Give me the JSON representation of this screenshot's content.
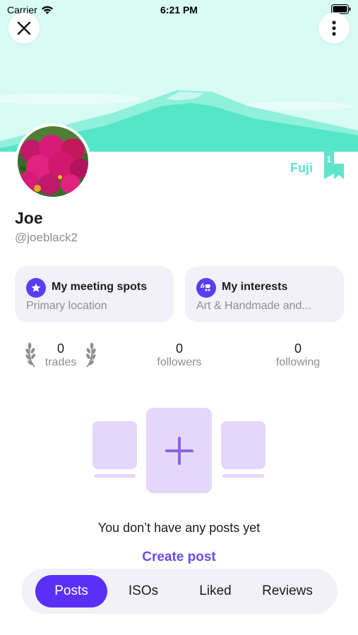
{
  "status_bar": {
    "carrier": "Carrier",
    "time": "6:21 PM"
  },
  "profile": {
    "display_name": "Joe",
    "handle": "@joeblack2",
    "badge_name": "Fuji",
    "badge_count": "1"
  },
  "cards": {
    "meeting_spots": {
      "title": "My meeting spots",
      "subtitle": "Primary location"
    },
    "interests": {
      "title": "My interests",
      "subtitle": "Art & Handmade and..."
    }
  },
  "stats": {
    "trades": {
      "value": "0",
      "label": "trades"
    },
    "followers": {
      "value": "0",
      "label": "followers"
    },
    "following": {
      "value": "0",
      "label": "following"
    }
  },
  "empty_state": {
    "message": "You don’t have any posts yet",
    "action": "Create post"
  },
  "tabs": [
    {
      "label": "Posts",
      "active": true
    },
    {
      "label": "ISOs",
      "active": false
    },
    {
      "label": "Liked",
      "active": false
    },
    {
      "label": "Reviews",
      "active": false
    }
  ],
  "colors": {
    "accent": "#5b2ff5",
    "link": "#6a4cf5",
    "cover_sky": "#d8fbf3",
    "cover_mountain": "#55e6c8",
    "card_bg": "#f2f1f8",
    "illustration": "#e4d7fb"
  },
  "icons": {
    "close": "close-icon",
    "more": "more-vertical-icon",
    "meeting_spots": "star-icon",
    "interests": "interests-icon",
    "trades": "laurel-icon",
    "create": "plus-icon"
  }
}
